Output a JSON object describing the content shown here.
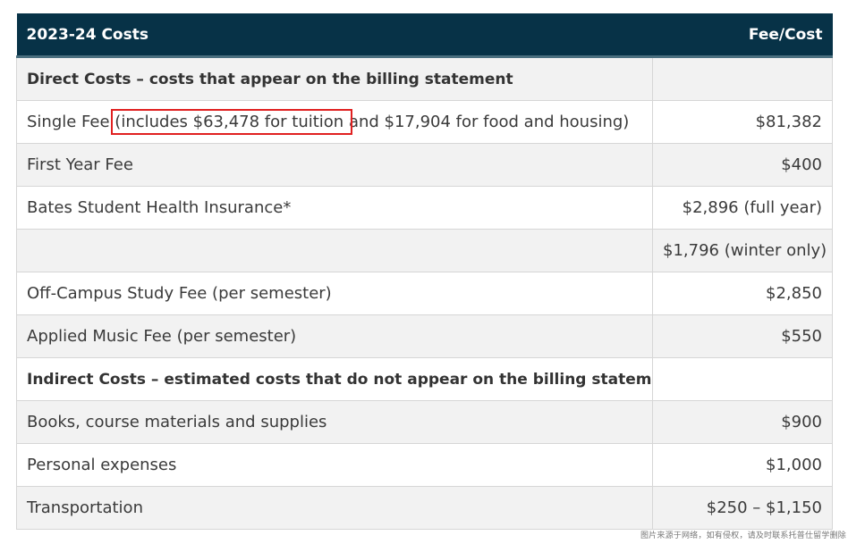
{
  "header": {
    "col1": "2023-24 Costs",
    "col2": "Fee/Cost"
  },
  "rows": [
    {
      "label": "Direct Costs – costs that appear on the billing statement",
      "amount": "",
      "section": true
    },
    {
      "label_pre": "Single Fee ",
      "label_hl": "(includes $63,478 for tuition ",
      "label_post": "and $17,904 for food and housing)",
      "amount": "$81,382"
    },
    {
      "label": "First Year Fee",
      "amount": "$400"
    },
    {
      "label": "Bates Student Health Insurance*",
      "amount": "$2,896 (full year)"
    },
    {
      "label": "",
      "amount": "$1,796 (winter only)"
    },
    {
      "label": "Off-Campus Study Fee (per semester)",
      "amount": "$2,850"
    },
    {
      "label": "Applied Music Fee (per semester)",
      "amount": "$550"
    },
    {
      "label": "Indirect Costs – estimated costs that do not appear on the billing statement",
      "amount": "",
      "section": true
    },
    {
      "label": "Books, course materials and supplies",
      "amount": "$900"
    },
    {
      "label": "Personal expenses",
      "amount": "$1,000"
    },
    {
      "label": "Transportation",
      "amount": "$250 – $1,150"
    }
  ],
  "watermark": "图片来源于网络，如有侵权，请及时联系托普仕留学删除",
  "colors": {
    "header_bg": "#073247",
    "highlight": "#e02020",
    "stripe": "#f2f2f2"
  }
}
